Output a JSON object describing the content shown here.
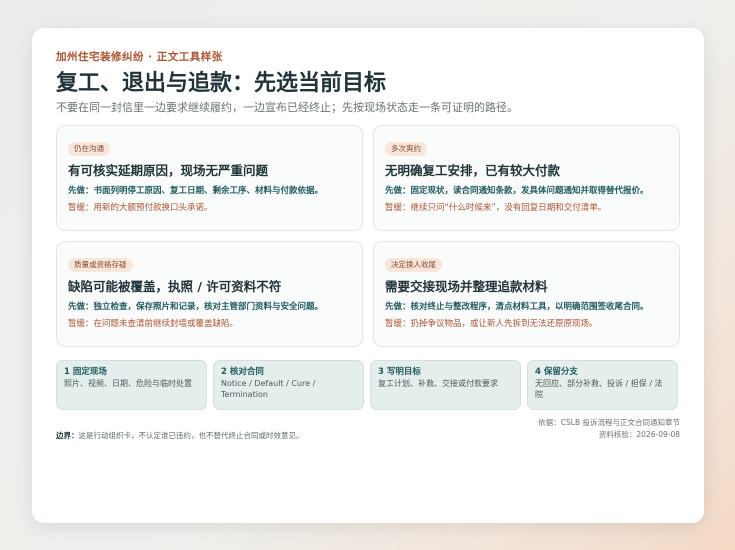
{
  "header": {
    "kicker": "加州住宅装修纠纷 · 正文工具样张",
    "title": "复工、退出与追款：先选当前目标",
    "subtitle": "不要在同一封信里一边要求继续履约，一边宣布已经终止；先按现场状态走一条可证明的路径。"
  },
  "options": [
    {
      "tag": "仍在沟通",
      "heading": "有可核实延期原因，现场无严重问题",
      "do": "先做：书面列明停工原因、复工日期、剩余工序、材料与付款依据。",
      "stop": "暂缓：用新的大额预付款换口头承诺。"
    },
    {
      "tag": "多次爽约",
      "heading": "无明确复工安排，已有较大付款",
      "do": "先做：固定现状，读合同通知条款，发具体问题通知并取得替代报价。",
      "stop": "暂缓：继续只问“什么时候来”，没有回复日期和交付清单。"
    },
    {
      "tag": "质量或资格存疑",
      "heading": "缺陷可能被覆盖，执照 / 许可资料不符",
      "do": "先做：独立检查，保存照片和记录，核对主管部门资料与安全问题。",
      "stop": "暂缓：在问题未查清前继续封墙或覆盖缺陷。"
    },
    {
      "tag": "决定换人收尾",
      "heading": "需要交接现场并整理追款材料",
      "do": "先做：核对终止与整改程序，清点材料工具，以明确范围签收尾合同。",
      "stop": "暂缓：扔掉争议物品，或让新人先拆到无法还原原现场。"
    }
  ],
  "steps": [
    {
      "title": "1 固定现场",
      "desc": "照片、视频、日期、危险与临时处置"
    },
    {
      "title": "2 核对合同",
      "desc": "Notice / Default / Cure / Termination"
    },
    {
      "title": "3 写明目标",
      "desc": "复工计划、补救、交接或付款要求"
    },
    {
      "title": "4 保留分支",
      "desc": "无回应、部分补救、投诉 / 担保 / 法院"
    }
  ],
  "footer": {
    "boundary_label": "边界：",
    "boundary_text": "这是行动组织卡，不认定谁已违约，也不替代终止合同或时效意见。",
    "source": "依据：CSLB 投诉流程与正文合同通知章节",
    "checked": "资料核验：2026-09-08"
  },
  "colors": {
    "accent": "#b0532f",
    "teal": "#1f5b5e",
    "heading": "#1f3338",
    "step_bg": "#e4eeec",
    "tag_bg": "#f7e6da"
  }
}
